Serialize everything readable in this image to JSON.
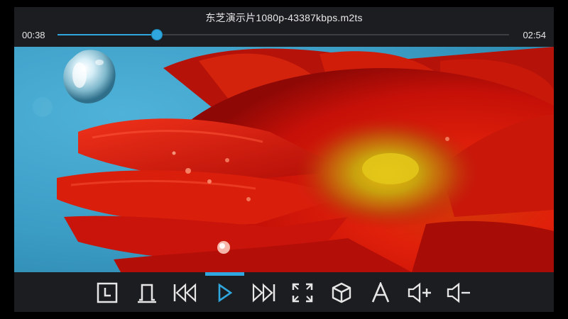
{
  "player": {
    "title": "东芝演示片1080p-43387kbps.m2ts",
    "current_time": "00:38",
    "duration": "02:54",
    "progress": 0.22
  },
  "controls": {
    "selected": "play",
    "buttons": [
      {
        "name": "clock",
        "icon": "clock-icon"
      },
      {
        "name": "audio-track",
        "icon": "audio-track-icon"
      },
      {
        "name": "previous",
        "icon": "previous-icon"
      },
      {
        "name": "play",
        "icon": "play-icon"
      },
      {
        "name": "next",
        "icon": "next-icon"
      },
      {
        "name": "fullscreen",
        "icon": "fullscreen-icon"
      },
      {
        "name": "3d",
        "icon": "3d-cube-icon"
      },
      {
        "name": "subtitle",
        "icon": "subtitle-letter-a-icon"
      },
      {
        "name": "volume-up",
        "icon": "volume-up-icon"
      },
      {
        "name": "volume-down",
        "icon": "volume-down-icon"
      }
    ]
  },
  "colors": {
    "accent": "#2fa6dd",
    "bar_background": "#1c1d20",
    "icon": "#e6e6e6"
  }
}
